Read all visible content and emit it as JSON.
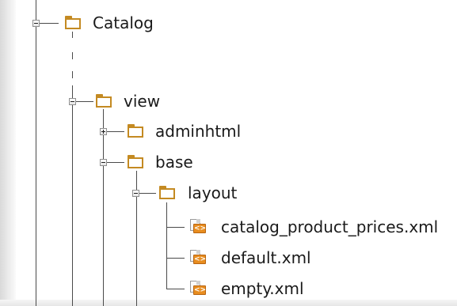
{
  "tree": {
    "catalog": {
      "label": "Catalog",
      "icon": "folder-icon",
      "state": "expanded"
    },
    "view": {
      "label": "view",
      "icon": "folder-icon",
      "state": "expanded"
    },
    "adminhtml": {
      "label": "adminhtml",
      "icon": "folder-icon",
      "state": "collapsed"
    },
    "base": {
      "label": "base",
      "icon": "folder-icon",
      "state": "expanded"
    },
    "layout": {
      "label": "layout",
      "icon": "folder-icon",
      "state": "expanded"
    },
    "files": [
      {
        "label": "catalog_product_prices.xml",
        "icon": "xml-file-icon"
      },
      {
        "label": "default.xml",
        "icon": "xml-file-icon"
      },
      {
        "label": "empty.xml",
        "icon": "xml-file-icon"
      }
    ]
  },
  "colors": {
    "folder": "#c48a22",
    "xml_badge": "#e88d1f",
    "tree_line": "#4a4a4a",
    "text": "#1a1a1a"
  }
}
